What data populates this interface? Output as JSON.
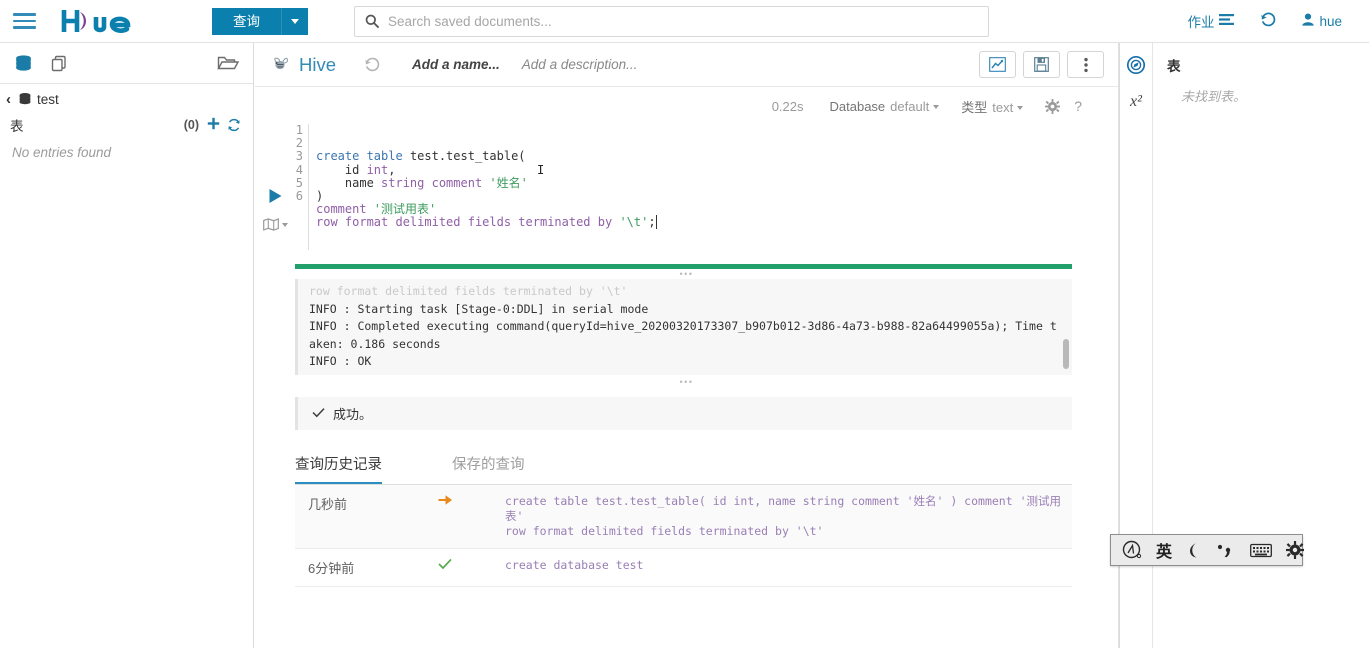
{
  "topnav": {
    "menu_icon": "hamburger-icon",
    "logo_text": "hue",
    "query_button": "查询",
    "query_caret": "chevron-down-icon",
    "search_placeholder": "Search saved documents...",
    "search_value": "",
    "search_icon": "search-icon",
    "jobs_label": "作业",
    "jobs_icon": "list-icon",
    "history_icon": "history-icon",
    "user_label": "hue",
    "user_icon": "person-icon"
  },
  "sidebar": {
    "tab_db_icon": "database-icon",
    "tab_docs_icon": "documents-icon",
    "folder_icon": "folder-open-icon",
    "breadcrumb_back": "‹",
    "breadcrumb_db": "test",
    "breadcrumb_db_icon": "database-icon",
    "tables_label": "表",
    "tables_count": "(0)",
    "add_icon": "plus-icon",
    "refresh_icon": "refresh-icon",
    "empty_text": "No entries found"
  },
  "editor": {
    "engine": "Hive",
    "engine_icon": "hive-bee-icon",
    "history_icon": "history-icon",
    "name_placeholder": "Add a name...",
    "description_placeholder": "Add a description...",
    "chart_button_icon": "chart-line-icon",
    "save_button_icon": "floppy-save-icon",
    "more_button_icon": "vertical-dots-icon",
    "status": {
      "elapsed": "0.22s",
      "database_label": "Database",
      "database_value": "default",
      "type_label": "类型",
      "type_value": "text",
      "settings_icon": "gear-icon",
      "help_icon": "question-mark-icon"
    },
    "run_icon": "play-triangle-icon",
    "map_icon": "map-icon",
    "code_lines": [
      {
        "n": "1",
        "tokens": [
          {
            "t": "create ",
            "c": "kw"
          },
          {
            "t": "table ",
            "c": "kw"
          },
          {
            "t": "test.test_table(",
            "c": "id"
          }
        ]
      },
      {
        "n": "2",
        "tokens": [
          {
            "t": "    id ",
            "c": "id"
          },
          {
            "t": "int",
            "c": "kw2"
          },
          {
            "t": ",",
            "c": "id"
          }
        ]
      },
      {
        "n": "3",
        "tokens": [
          {
            "t": "    name ",
            "c": "id"
          },
          {
            "t": "string ",
            "c": "kw2"
          },
          {
            "t": "comment ",
            "c": "kw2"
          },
          {
            "t": "'姓名'",
            "c": "str"
          }
        ]
      },
      {
        "n": "4",
        "tokens": [
          {
            "t": ")",
            "c": "id"
          }
        ]
      },
      {
        "n": "5",
        "tokens": [
          {
            "t": "comment ",
            "c": "kw2"
          },
          {
            "t": "'测试用表'",
            "c": "str"
          }
        ]
      },
      {
        "n": "6",
        "tokens": [
          {
            "t": "row format delimited fields terminated by ",
            "c": "kw2"
          },
          {
            "t": "'\\t'",
            "c": "str"
          },
          {
            "t": ";",
            "c": "id"
          }
        ]
      }
    ]
  },
  "progress": {
    "percent": 100,
    "color": "#21a06c"
  },
  "log": {
    "faded_line": "row format delimited fields terminated by '\\t'",
    "lines": [
      "INFO  : Starting task [Stage-0:DDL] in serial mode",
      "INFO  : Completed executing command(queryId=hive_20200320173307_b907b012-3d86-4a73-b988-82a64499055a); Time taken: 0.186 seconds",
      "INFO  : OK"
    ]
  },
  "result": {
    "check_icon": "check-icon",
    "message": "成功。"
  },
  "tabs": [
    {
      "label": "查询历史记录",
      "active": true
    },
    {
      "label": "保存的查询",
      "active": false
    }
  ],
  "history": [
    {
      "time": "几秒前",
      "status_icon": "orange-arrow-icon",
      "status_color": "#e8891c",
      "code": "create table test.test_table( id int, name string comment '姓名' ) comment '测试用表'\nrow format delimited fields terminated by '\\t'"
    },
    {
      "time": "6分钟前",
      "status_icon": "green-check-icon",
      "status_color": "#5aa84f",
      "code": "create database test"
    }
  ],
  "right_panel": {
    "rail": [
      {
        "icon": "assist-compass-icon",
        "active": true
      },
      {
        "icon": "chi-squared-icon",
        "label": "x²",
        "active": false
      }
    ],
    "title": "表",
    "empty_text": "未找到表。"
  },
  "ime_bar": {
    "items": [
      {
        "icon": "ime-logo-icon",
        "label": ""
      },
      {
        "icon": "ime-lang-icon",
        "label": "英"
      },
      {
        "icon": "ime-moon-icon",
        "label": ""
      },
      {
        "icon": "ime-punctuation-icon",
        "label": ""
      },
      {
        "icon": "ime-keyboard-icon",
        "label": ""
      },
      {
        "icon": "ime-settings-icon",
        "label": ""
      }
    ]
  },
  "colors": {
    "brand_blue": "#0b7fad",
    "link_blue": "#1b7ca8",
    "success_green": "#21a06c",
    "string_green": "#3c9c5e",
    "history_code": "#9a7fb5"
  }
}
